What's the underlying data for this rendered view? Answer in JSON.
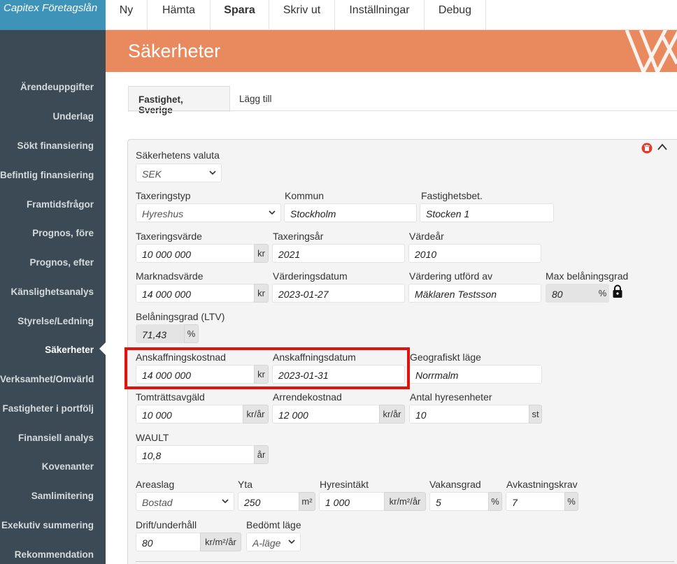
{
  "app": {
    "title": "Capitex Företagslån"
  },
  "menu": [
    "Ny",
    "Hämta",
    "Spara",
    "Skriv ut",
    "Inställningar",
    "Debug"
  ],
  "sidebar": {
    "items": [
      "Ärendeuppgifter",
      "Underlag",
      "Sökt finansiering",
      "Befintlig finansiering",
      "Framtidsfrågor",
      "Prognos, före",
      "Prognos, efter",
      "Känslighetsanalys",
      "Styrelse/Ledning",
      "Säkerheter",
      "Verksamhet/Omvärld",
      "Fastigheter i portfölj",
      "Finansiell analys",
      "Kovenanter",
      "Samlimitering",
      "Exekutiv summering",
      "Rekommendation"
    ],
    "active": "Säkerheter"
  },
  "page": {
    "title": "Säkerheter"
  },
  "tabs": {
    "active": "Fastighet, Sverige",
    "add": "Lägg till"
  },
  "form": {
    "currency": {
      "label": "Säkerhetens valuta",
      "value": "SEK"
    },
    "taxeringstyp": {
      "label": "Taxeringstyp",
      "value": "Hyreshus"
    },
    "kommun": {
      "label": "Kommun",
      "value": "Stockholm"
    },
    "fastighetsbet": {
      "label": "Fastighetsbet.",
      "value": "Stocken 1"
    },
    "taxeringsvarde": {
      "label": "Taxeringsvärde",
      "value": "10 000 000",
      "unit": "kr"
    },
    "taxeringsar": {
      "label": "Taxeringsår",
      "value": "2021"
    },
    "vardear": {
      "label": "Värdeår",
      "value": "2010"
    },
    "marknadsvarde": {
      "label": "Marknadsvärde",
      "value": "14 000 000",
      "unit": "kr"
    },
    "varderingsdatum": {
      "label": "Värderingsdatum",
      "value": "2023-01-27"
    },
    "vardering_utford_av": {
      "label": "Värdering utförd av",
      "value": "Mäklaren Testsson"
    },
    "max_belaningsgrad": {
      "label": "Max belåningsgrad",
      "value": "80",
      "unit": "%"
    },
    "belaningsgrad": {
      "label": "Belåningsgrad (LTV)",
      "value": "71,43",
      "unit": "%"
    },
    "anskaffningskostnad": {
      "label": "Anskaffningskostnad",
      "value": "14 000 000",
      "unit": "kr"
    },
    "anskaffningsdatum": {
      "label": "Anskaffningsdatum",
      "value": "2023-01-31"
    },
    "geografiskt_lage": {
      "label": "Geografiskt läge",
      "value": "Norrmalm"
    },
    "tomtrattsavgald": {
      "label": "Tomträttsavgäld",
      "value": "10 000",
      "unit": "kr/år"
    },
    "arrendekostnad": {
      "label": "Arrendekostnad",
      "value": "12 000",
      "unit": "kr/år"
    },
    "antal_hyresenheter": {
      "label": "Antal hyresenheter",
      "value": "10",
      "unit": "st"
    },
    "wault": {
      "label": "WAULT",
      "value": "10,8",
      "unit": "år"
    },
    "areaslag": {
      "label": "Areaslag",
      "value": "Bostad"
    },
    "yta": {
      "label": "Yta",
      "value": "250",
      "unit": "m²"
    },
    "hyresintakt": {
      "label": "Hyresintäkt",
      "value": "1 000",
      "unit": "kr/m²/år"
    },
    "vakansgrad": {
      "label": "Vakansgrad",
      "value": "5",
      "unit": "%"
    },
    "avkastningskrav": {
      "label": "Avkastningskrav",
      "value": "7",
      "unit": "%"
    },
    "drift_underhall": {
      "label": "Drift/underhåll",
      "value": "80",
      "unit": "kr/m²/år"
    },
    "bedomt_lage": {
      "label": "Bedömt läge",
      "value": "A-läge"
    }
  },
  "icons": {
    "delete": "trash-icon",
    "collapse": "chevron-up-icon",
    "lock": "lock-icon"
  },
  "colors": {
    "sidebar": "#3b4a54",
    "brand": "#3d93b8",
    "banner": "#e8895e",
    "highlight": "#e0120e",
    "delete": "#e23b2e"
  }
}
